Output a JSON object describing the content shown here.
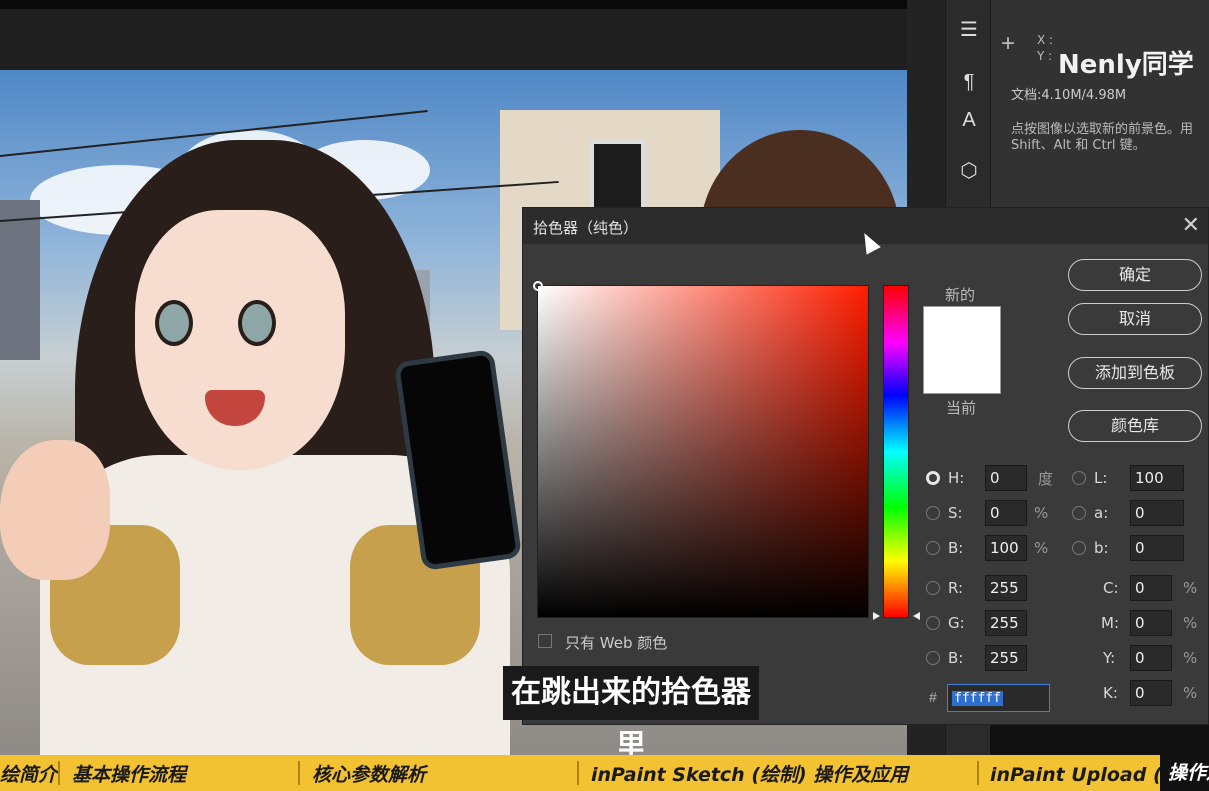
{
  "info_panel": {
    "cursor_icon": "crosshair-icon",
    "x_label": "X :",
    "y_label": "Y :",
    "doc_size": "文档:4.10M/4.98M",
    "hint": "点按图像以选取新的前景色。用 Shift、Alt 和 Ctrl 键。"
  },
  "watermark": "Nenly同学",
  "tool_strip": {
    "icons": [
      "adjustments-icon",
      "paragraph-style-icon",
      "character-style-icon",
      "3d-cube-icon"
    ]
  },
  "picker": {
    "title": "拾色器（纯色）",
    "close_icon": "close-icon",
    "new_label": "新的",
    "current_label": "当前",
    "new_color": "#ffffff",
    "current_color": "#ffffff",
    "hue_base": "#ff1d00",
    "buttons": {
      "ok": "确定",
      "cancel": "取消",
      "add_swatch": "添加到色板",
      "color_library": "颜色库"
    },
    "web_only_label": "只有 Web 颜色",
    "web_only_checked": false,
    "fields": {
      "H": {
        "label": "H:",
        "value": "0",
        "unit": "度",
        "selected": true
      },
      "S": {
        "label": "S:",
        "value": "0",
        "unit": "%"
      },
      "Bv": {
        "label": "B:",
        "value": "100",
        "unit": "%"
      },
      "R": {
        "label": "R:",
        "value": "255"
      },
      "G": {
        "label": "G:",
        "value": "255"
      },
      "Bl": {
        "label": "B:",
        "value": "255"
      },
      "L": {
        "label": "L:",
        "value": "100"
      },
      "a": {
        "label": "a:",
        "value": "0"
      },
      "b": {
        "label": "b:",
        "value": "0"
      },
      "C": {
        "label": "C:",
        "value": "0",
        "unit": "%"
      },
      "M": {
        "label": "M:",
        "value": "0",
        "unit": "%"
      },
      "Y": {
        "label": "Y:",
        "value": "0",
        "unit": "%"
      },
      "K": {
        "label": "K:",
        "value": "0",
        "unit": "%"
      }
    },
    "hex_label": "#",
    "hex_value": "ffffff"
  },
  "subtitle": "在跳出来的拾色器里",
  "chapters": {
    "items": [
      "绘简介",
      "基本操作流程",
      "核心参数解析",
      "inPaint Sketch (绘制) 操作及应用",
      "inPaint Upload (上传蒙版)"
    ],
    "active": "操作及应用"
  },
  "colors": {
    "chapter_bar": "#f2c232",
    "dialog_bg": "#3a3a3a",
    "accent_blue": "#2f6fd0"
  }
}
